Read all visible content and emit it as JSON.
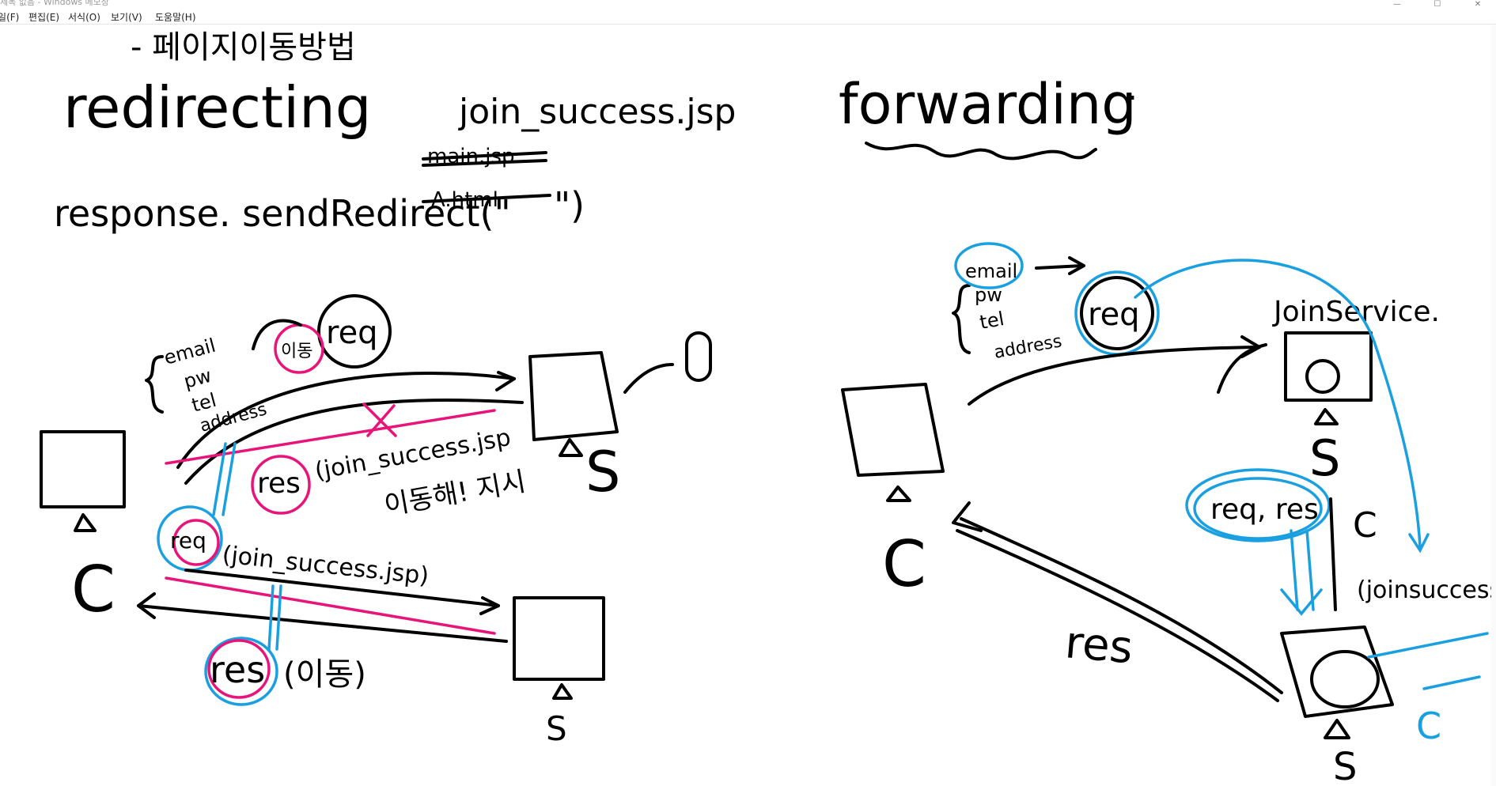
{
  "window": {
    "title": "제목 없음 - Windows 메모장",
    "minimize_glyph": "—",
    "maximize_glyph": "☐",
    "close_glyph": "✕"
  },
  "menu": [
    {
      "label": "파일(F)"
    },
    {
      "label": "편집(E)"
    },
    {
      "label": "서식(O)"
    },
    {
      "label": "보기(V)"
    },
    {
      "label": "도움말(H)"
    }
  ],
  "drawing": {
    "heading": "- 페이지이동방법",
    "left": {
      "title": "redirecting",
      "target_file": "join_success.jsp",
      "code_prefix": "response. sendRedirect(\"",
      "strike_1": "main.jsp",
      "strike_2": "A.html",
      "code_suffix": "\")",
      "params": [
        "email",
        "pw",
        "tel",
        "address"
      ],
      "req_label": "req",
      "note_move": "이동",
      "res_label": "res",
      "res_note": "(join_success.jsp",
      "instruction": "이동해! 지시",
      "req2_label": "req",
      "req2_note": "(join_success.jsp)",
      "res2_label": "res",
      "res2_note": "(이동)",
      "client_label": "C",
      "server_label_1": "S",
      "server_label_2": "S"
    },
    "right": {
      "title": "forwarding",
      "title_dot": ".",
      "params": [
        "email",
        "pw",
        "tel",
        "address"
      ],
      "req_label": "req",
      "service_label": "JoinService.",
      "server_label_1": "S",
      "req_res_label": "req, res",
      "c_mark": "C",
      "target_file": "(joinsuccess .jsp)",
      "client_label": "C",
      "res_label": "res",
      "server_label_2": "S",
      "circle_mark": "C"
    }
  }
}
